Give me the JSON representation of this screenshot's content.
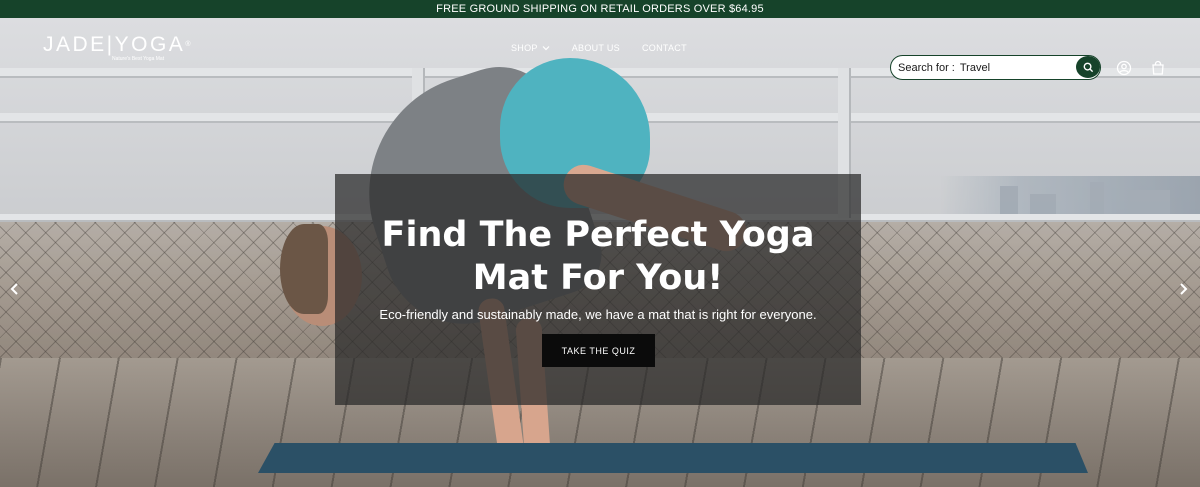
{
  "announcement": {
    "text": "FREE GROUND SHIPPING ON RETAIL ORDERS OVER $64.95"
  },
  "header": {
    "logo": {
      "text": "JADE|YOGA",
      "trademark": "®",
      "tagline": "Nature's Best Yoga Mat"
    },
    "nav": [
      {
        "label": "SHOP",
        "icon": "chevron-down-icon"
      },
      {
        "label": "ABOUT US"
      },
      {
        "label": "CONTACT"
      }
    ],
    "search": {
      "prefix": "Search for :",
      "value": "Travel",
      "icon": "search-icon"
    },
    "icons": [
      "account-icon",
      "cart-icon"
    ]
  },
  "hero": {
    "headline_line1": "Find The Perfect Yoga",
    "headline_line2": "Mat For You!",
    "subtext": "Eco-friendly and sustainably made, we have a mat that is right for everyone.",
    "cta_label": "TAKE THE QUIZ",
    "prev_icon": "chevron-left-icon",
    "next_icon": "chevron-right-icon"
  },
  "colors": {
    "brand_green": "#16432a",
    "overlay": "rgba(40,40,40,0.72)",
    "cta_bg": "#0b0b0b"
  }
}
